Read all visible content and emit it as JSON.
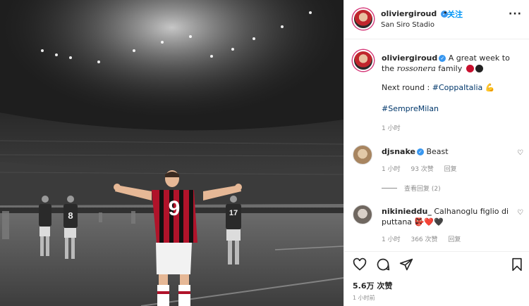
{
  "post": {
    "username": "oliviergiroud",
    "follow_label": "关注",
    "dot": "•",
    "location": "San Siro Stadio",
    "more": "···"
  },
  "player": {
    "number": "9"
  },
  "opponent": {
    "left_number": "8",
    "right_number": "17"
  },
  "caption": {
    "username": "oliviergiroud",
    "text_start": "A great week to the",
    "text_script": "rossonera",
    "text_family": "family",
    "next_round": "Next round : ",
    "hashtag1": "#CoppaItalia",
    "flex_emoji": "💪",
    "hashtag2": "#SempreMilan",
    "time": "1 小时"
  },
  "comments": [
    {
      "username": "djsnake",
      "text": "Beast",
      "time": "1 小时",
      "likes": "93 次赞",
      "reply": "回复",
      "view_replies": "查看回复 (2)"
    },
    {
      "username": "nikinieddu_",
      "text": "Calhanoglu figlio di puttana",
      "emoji": "👺❤️🖤",
      "time": "1 小时",
      "likes": "366 次赞",
      "reply": "回复"
    }
  ],
  "likes_count": "5.6万 次赞",
  "post_time": "1 小时前",
  "colors": {
    "link": "#0095f6",
    "hashtag": "#00376b",
    "milan_red": "#c8102e"
  },
  "icons": [
    "more-icon",
    "heart-icon",
    "comment-icon",
    "share-icon",
    "bookmark-icon",
    "verified-icon"
  ]
}
